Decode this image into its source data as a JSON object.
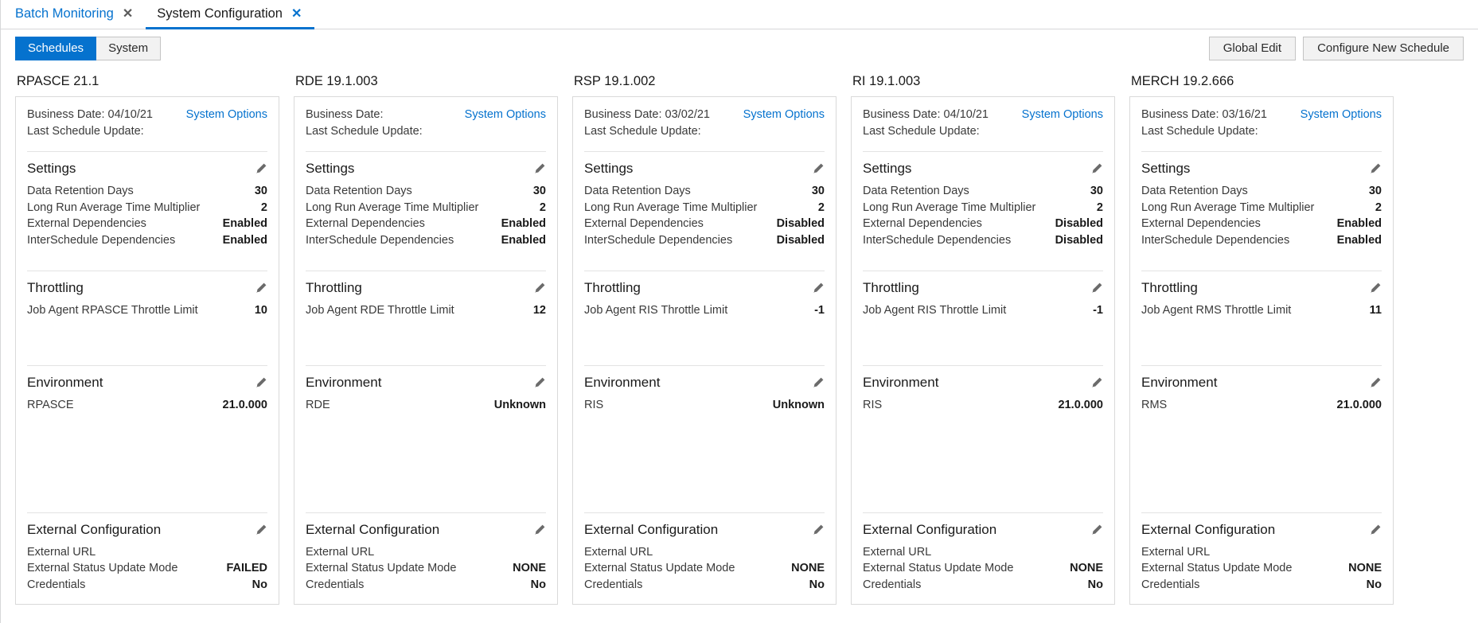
{
  "tabs": [
    {
      "label": "Batch Monitoring",
      "active": false,
      "close_icon": "✕"
    },
    {
      "label": "System Configuration",
      "active": true,
      "close_icon": "✕"
    }
  ],
  "toolbar": {
    "segmented": [
      {
        "label": "Schedules",
        "active": true
      },
      {
        "label": "System",
        "active": false
      }
    ],
    "global_edit_label": "Global Edit",
    "configure_new_schedule_label": "Configure New Schedule"
  },
  "labels": {
    "business_date_prefix": "Business Date:",
    "last_schedule_update_prefix": "Last Schedule Update:",
    "system_options": "System Options",
    "settings": "Settings",
    "throttling": "Throttling",
    "environment": "Environment",
    "external_configuration": "External Configuration",
    "data_retention_days": "Data Retention Days",
    "long_run_average_time_multiplier": "Long Run Average Time Multiplier",
    "external_dependencies": "External Dependencies",
    "interschedule_dependencies": "InterSchedule Dependencies",
    "external_url": "External URL",
    "external_status_update_mode": "External Status Update Mode",
    "credentials": "Credentials"
  },
  "colors": {
    "accent": "#0572ce",
    "card_border": "#d9d9d9",
    "text": "#252525"
  },
  "cards": [
    {
      "title": "RPASCE 21.1",
      "business_date": "Business Date: 04/10/21",
      "last_schedule_update": "Last Schedule Update:",
      "system_options": "System Options",
      "settings": {
        "data_retention_days": "30",
        "long_run_average_time_multiplier": "2",
        "external_dependencies": "Enabled",
        "interschedule_dependencies": "Enabled"
      },
      "throttling": {
        "label": "Job Agent RPASCE Throttle Limit",
        "value": "10"
      },
      "environment": {
        "label": "RPASCE",
        "value": "21.0.000"
      },
      "external_configuration": {
        "external_url": "",
        "external_status_update_mode": "FAILED",
        "credentials": "No"
      }
    },
    {
      "title": "RDE 19.1.003",
      "business_date": "Business Date:",
      "last_schedule_update": "Last Schedule Update:",
      "system_options": "System Options",
      "settings": {
        "data_retention_days": "30",
        "long_run_average_time_multiplier": "2",
        "external_dependencies": "Enabled",
        "interschedule_dependencies": "Enabled"
      },
      "throttling": {
        "label": "Job Agent RDE Throttle Limit",
        "value": "12"
      },
      "environment": {
        "label": "RDE",
        "value": "Unknown"
      },
      "external_configuration": {
        "external_url": "",
        "external_status_update_mode": "NONE",
        "credentials": "No"
      }
    },
    {
      "title": "RSP 19.1.002",
      "business_date": "Business Date: 03/02/21",
      "last_schedule_update": "Last Schedule Update:",
      "system_options": "System Options",
      "settings": {
        "data_retention_days": "30",
        "long_run_average_time_multiplier": "2",
        "external_dependencies": "Disabled",
        "interschedule_dependencies": "Disabled"
      },
      "throttling": {
        "label": "Job Agent RIS Throttle Limit",
        "value": "-1"
      },
      "environment": {
        "label": "RIS",
        "value": "Unknown"
      },
      "external_configuration": {
        "external_url": "",
        "external_status_update_mode": "NONE",
        "credentials": "No"
      }
    },
    {
      "title": "RI 19.1.003",
      "business_date": "Business Date: 04/10/21",
      "last_schedule_update": "Last Schedule Update:",
      "system_options": "System Options",
      "settings": {
        "data_retention_days": "30",
        "long_run_average_time_multiplier": "2",
        "external_dependencies": "Disabled",
        "interschedule_dependencies": "Disabled"
      },
      "throttling": {
        "label": "Job Agent RIS Throttle Limit",
        "value": "-1"
      },
      "environment": {
        "label": "RIS",
        "value": "21.0.000"
      },
      "external_configuration": {
        "external_url": "",
        "external_status_update_mode": "NONE",
        "credentials": "No"
      }
    },
    {
      "title": "MERCH 19.2.666",
      "business_date": "Business Date: 03/16/21",
      "last_schedule_update": "Last Schedule Update:",
      "system_options": "System Options",
      "settings": {
        "data_retention_days": "30",
        "long_run_average_time_multiplier": "2",
        "external_dependencies": "Enabled",
        "interschedule_dependencies": "Enabled"
      },
      "throttling": {
        "label": "Job Agent RMS Throttle Limit",
        "value": "11"
      },
      "environment": {
        "label": "RMS",
        "value": "21.0.000"
      },
      "external_configuration": {
        "external_url": "",
        "external_status_update_mode": "NONE",
        "credentials": "No"
      }
    }
  ]
}
